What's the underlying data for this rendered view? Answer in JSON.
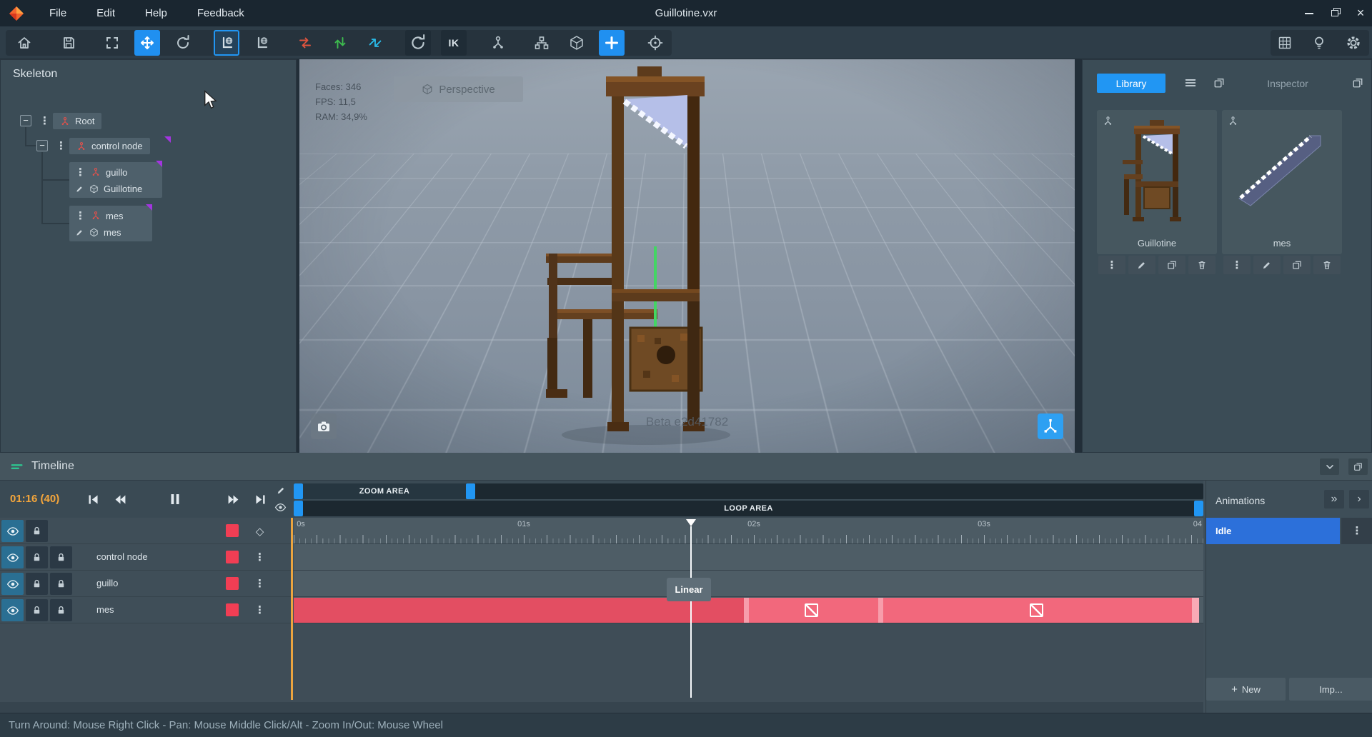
{
  "colors": {
    "accent_blue": "#2196f3",
    "selection_blue": "#2c70da",
    "keyframe_red": "#e34e62",
    "chip_red": "#f13e54",
    "time_orange": "#f5a63b"
  },
  "titlebar": {
    "title": "Guillotine.vxr",
    "menus": [
      {
        "label": "File"
      },
      {
        "label": "Edit"
      },
      {
        "label": "Help"
      },
      {
        "label": "Feedback"
      }
    ]
  },
  "toolbar": {
    "ik_label": "IK"
  },
  "skeleton_panel": {
    "title": "Skeleton",
    "root_label": "Root",
    "control_label": "control node",
    "guillo_label": "guillo",
    "guillotine_label": "Guillotine",
    "mes_label": "mes",
    "mes_mesh_label": "mes"
  },
  "viewport": {
    "faces": "Faces: 346",
    "fps": "FPS: 11,5",
    "ram": "RAM: 34,9%",
    "camera_mode": "Perspective",
    "watermark": "Beta e2d41782"
  },
  "library": {
    "tab_library": "Library",
    "tab_inspector": "Inspector",
    "items": [
      {
        "name": "Guillotine"
      },
      {
        "name": "mes"
      }
    ]
  },
  "timeline": {
    "title": "Timeline",
    "time_display": "01:16 (40)",
    "zoom_area": "ZOOM AREA",
    "loop_area": "LOOP AREA",
    "ruler": [
      "0s",
      "01s",
      "02s",
      "03s",
      "04"
    ],
    "tracks": [
      {
        "name": "control node"
      },
      {
        "name": "guillo"
      },
      {
        "name": "mes"
      }
    ],
    "keyframe_tooltip": "Linear"
  },
  "animations": {
    "title": "Animations",
    "items": [
      {
        "name": "Idle"
      }
    ],
    "new_button": "New",
    "import_button": "Imp..."
  },
  "statusbar": {
    "text": "Turn Around: Mouse Right Click - Pan: Mouse Middle Click/Alt - Zoom In/Out: Mouse Wheel"
  }
}
